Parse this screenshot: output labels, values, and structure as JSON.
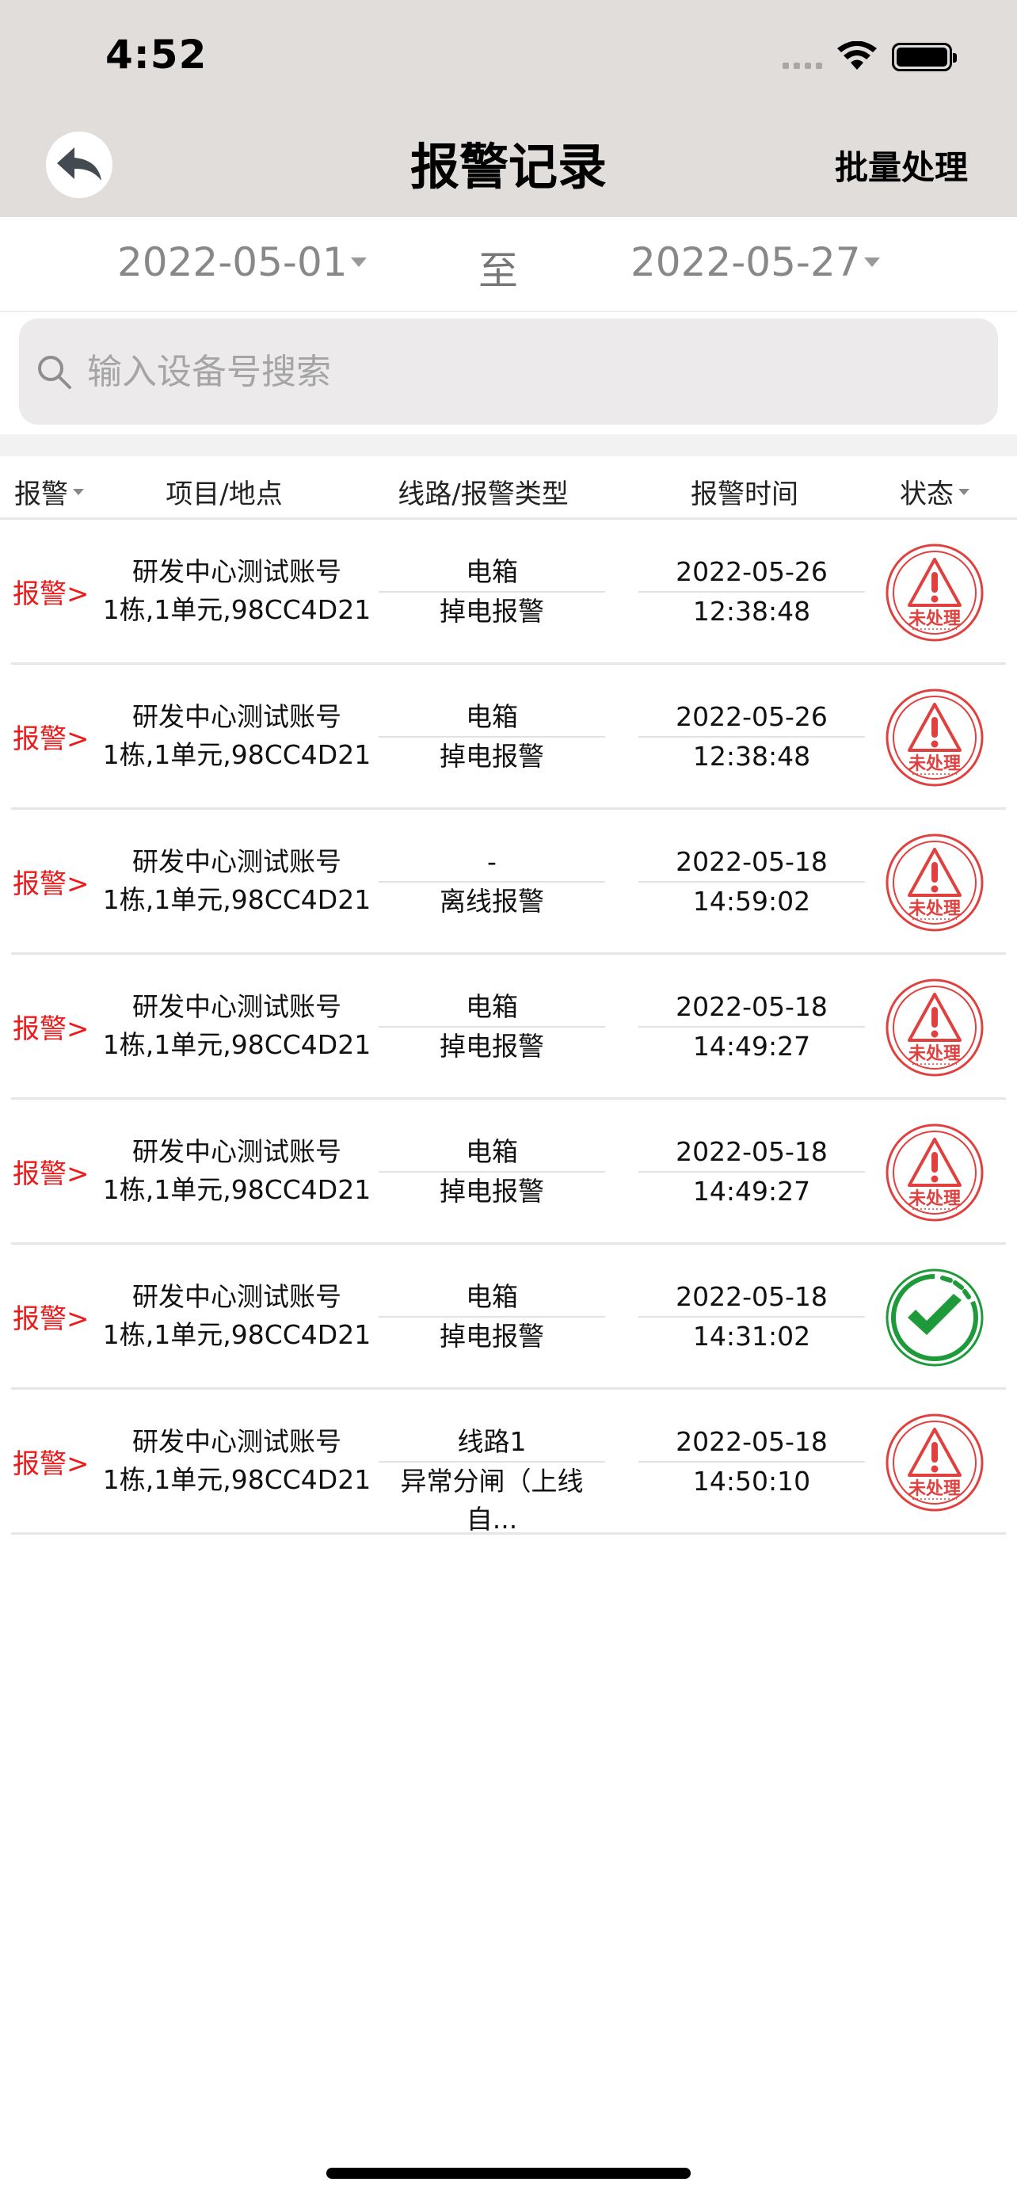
{
  "status_bar": {
    "time": "4:52"
  },
  "nav": {
    "title": "报警记录",
    "batch_label": "批量处理"
  },
  "date_range": {
    "start": "2022-05-01",
    "separator": "至",
    "end": "2022-05-27"
  },
  "search": {
    "placeholder": "输入设备号搜索",
    "value": ""
  },
  "table": {
    "headers": {
      "alarm": "报警",
      "project": "项目/地点",
      "line": "线路/报警类型",
      "time": "报警时间",
      "status": "状态"
    },
    "rows": [
      {
        "tag": "报警>",
        "project": "研发中心测试账号",
        "location": "1栋,1单元,98CC4D21",
        "line": "电箱",
        "alarm_type": "掉电报警",
        "date": "2022-05-26",
        "clock": "12:38:48",
        "status": "未处理"
      },
      {
        "tag": "报警>",
        "project": "研发中心测试账号",
        "location": "1栋,1单元,98CC4D21",
        "line": "电箱",
        "alarm_type": "掉电报警",
        "date": "2022-05-26",
        "clock": "12:38:48",
        "status": "未处理"
      },
      {
        "tag": "报警>",
        "project": "研发中心测试账号",
        "location": "1栋,1单元,98CC4D21",
        "line": "-",
        "alarm_type": "离线报警",
        "date": "2022-05-18",
        "clock": "14:59:02",
        "status": "未处理"
      },
      {
        "tag": "报警>",
        "project": "研发中心测试账号",
        "location": "1栋,1单元,98CC4D21",
        "line": "电箱",
        "alarm_type": "掉电报警",
        "date": "2022-05-18",
        "clock": "14:49:27",
        "status": "未处理"
      },
      {
        "tag": "报警>",
        "project": "研发中心测试账号",
        "location": "1栋,1单元,98CC4D21",
        "line": "电箱",
        "alarm_type": "掉电报警",
        "date": "2022-05-18",
        "clock": "14:49:27",
        "status": "未处理"
      },
      {
        "tag": "报警>",
        "project": "研发中心测试账号",
        "location": "1栋,1单元,98CC4D21",
        "line": "电箱",
        "alarm_type": "掉电报警",
        "date": "2022-05-18",
        "clock": "14:31:02",
        "status": "handled"
      },
      {
        "tag": "报警>",
        "project": "研发中心测试账号",
        "location": "1栋,1单元,98CC4D21",
        "line": "线路1",
        "alarm_type": "异常分闸（上线自...",
        "date": "2022-05-18",
        "clock": "14:50:10",
        "status": "未处理"
      }
    ]
  },
  "colors": {
    "alarm_red": "#ee1a1a",
    "handled_green": "#1f9a3a",
    "nav_bg": "#e0dddb"
  }
}
